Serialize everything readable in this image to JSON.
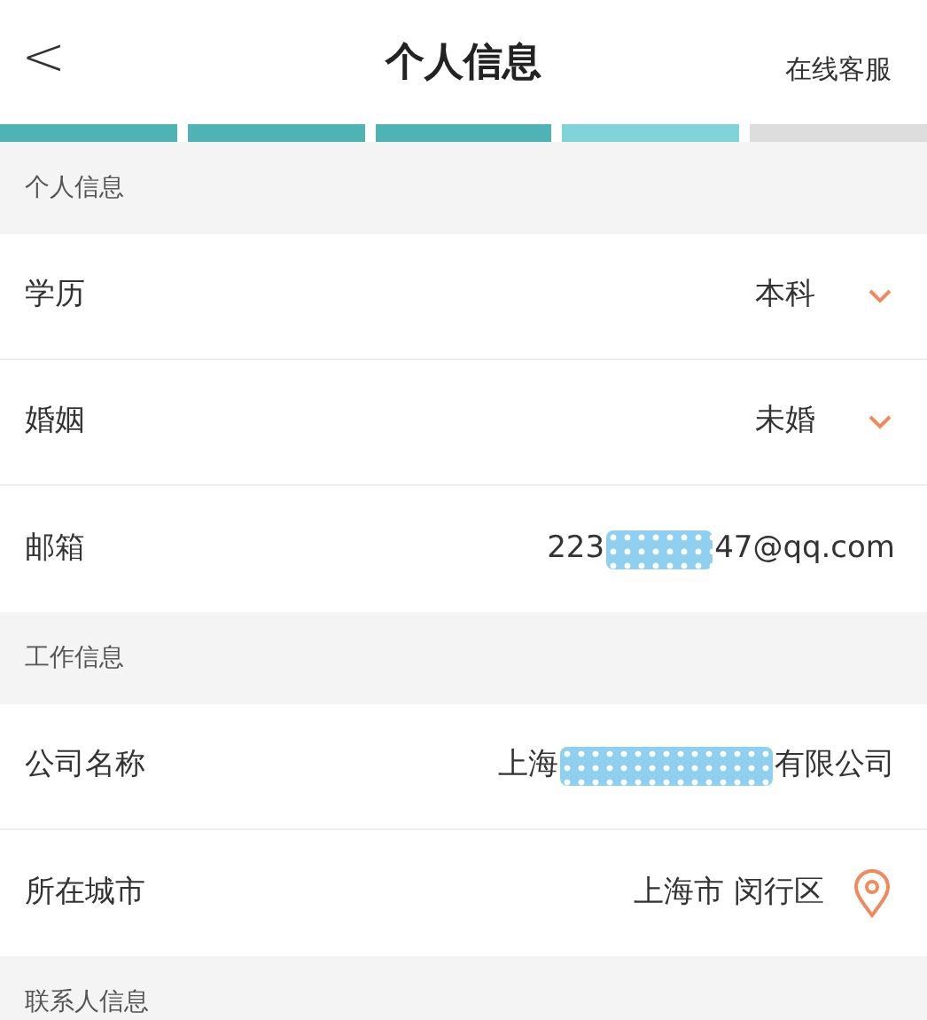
{
  "header": {
    "back": "<",
    "title": "个人信息",
    "service": "在线客服"
  },
  "progress": [
    {
      "done": true,
      "current": false
    },
    {
      "done": true,
      "current": false
    },
    {
      "done": true,
      "current": false
    },
    {
      "done": false,
      "current": true
    },
    {
      "done": false,
      "current": false
    }
  ],
  "sections": [
    {
      "title": "个人信息",
      "rows": [
        {
          "kind": "select",
          "label": "学历",
          "value": "本科"
        },
        {
          "kind": "select",
          "label": "婚姻",
          "value": "未婚"
        },
        {
          "kind": "masked",
          "label": "邮箱",
          "value_start": "223",
          "value_end": "47@qq.com"
        }
      ]
    },
    {
      "title": "工作信息",
      "rows": [
        {
          "kind": "masked",
          "label": "公司名称",
          "value_start": "上海",
          "value_end": "有限公司"
        },
        {
          "kind": "location",
          "label": "所在城市",
          "value": "上海市 闵行区"
        }
      ]
    },
    {
      "title": "联系人信息"
    }
  ]
}
